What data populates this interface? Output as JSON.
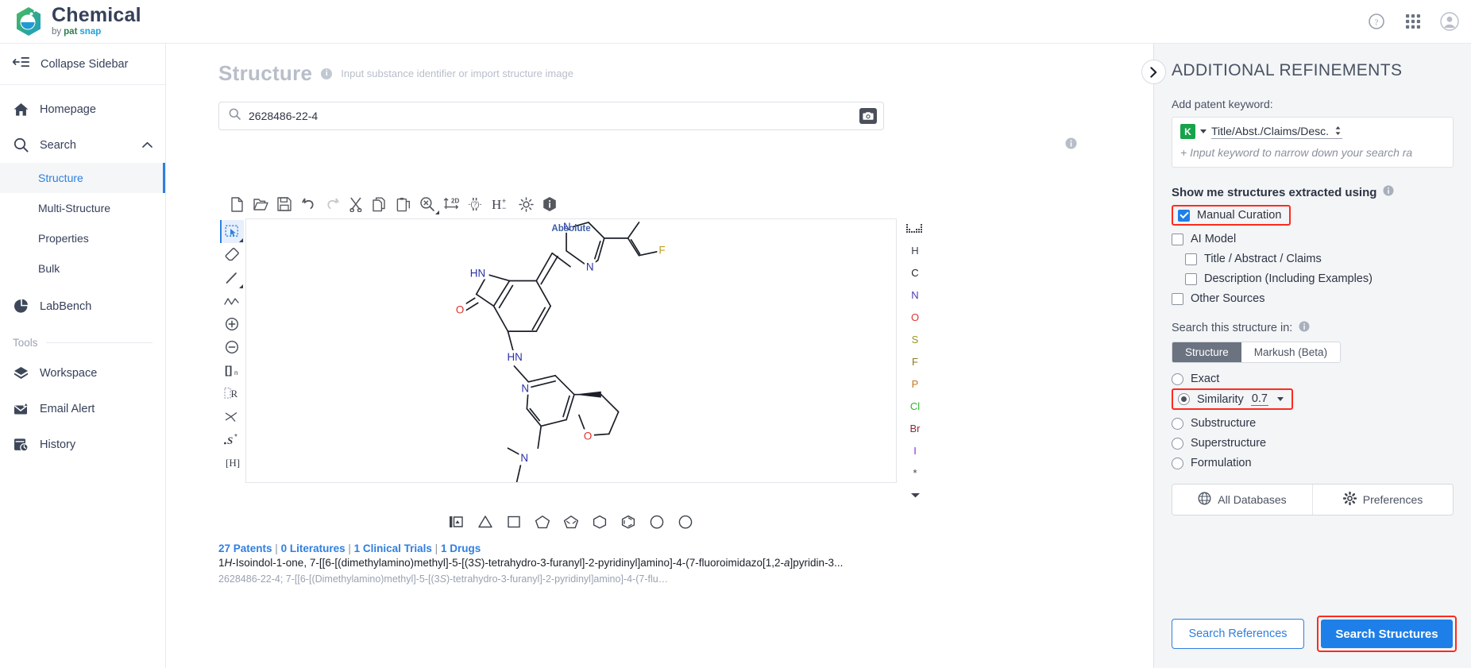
{
  "brand": {
    "name": "Chemical",
    "by": "by",
    "pat": "pat",
    "snap": "snap"
  },
  "topbar": {
    "help_icon": "help-circle-icon",
    "apps_icon": "grid-apps-icon",
    "avatar_icon": "user-avatar-icon"
  },
  "sidebar": {
    "collapse_label": "Collapse Sidebar",
    "items": [
      {
        "label": "Homepage",
        "icon": "home-icon"
      },
      {
        "label": "Search",
        "icon": "search-icon",
        "expanded": true
      }
    ],
    "search_children": [
      {
        "label": "Structure",
        "active": true
      },
      {
        "label": "Multi-Structure",
        "active": false
      },
      {
        "label": "Properties",
        "active": false
      },
      {
        "label": "Bulk",
        "active": false
      }
    ],
    "labbench": {
      "label": "LabBench",
      "icon": "pie-chart-icon"
    },
    "tools_header": "Tools",
    "tools": [
      {
        "label": "Workspace",
        "icon": "cube-icon"
      },
      {
        "label": "Email Alert",
        "icon": "mail-alert-icon"
      },
      {
        "label": "History",
        "icon": "history-clock-icon"
      }
    ]
  },
  "main": {
    "page_title": "Structure",
    "page_subtitle": "Input substance identifier or import structure image",
    "search_value": "2628486-22-4",
    "search_placeholder": "Input substance identifier or import structure image",
    "camera_icon": "camera-icon",
    "toolbar": [
      {
        "name": "new-file-icon",
        "title": "New"
      },
      {
        "name": "open-folder-icon",
        "title": "Open"
      },
      {
        "name": "save-disk-icon",
        "title": "Save"
      },
      {
        "name": "undo-icon",
        "title": "Undo"
      },
      {
        "name": "redo-icon",
        "title": "Redo"
      },
      {
        "name": "cut-scissors-icon",
        "title": "Cut"
      },
      {
        "name": "copy-icon",
        "title": "Copy"
      },
      {
        "name": "paste-icon",
        "title": "Paste"
      },
      {
        "name": "zoom-select-icon",
        "title": "Zoom"
      },
      {
        "name": "layout-2d-icon",
        "title": "2D Layout"
      },
      {
        "name": "query-properties-icon",
        "title": "Query"
      },
      {
        "name": "hydrogen-charge-icon",
        "title": "H +/-"
      },
      {
        "name": "settings-gear-icon",
        "title": "Settings"
      },
      {
        "name": "about-info-icon",
        "title": "About"
      }
    ],
    "left_tools": [
      {
        "name": "select-rectangle-tool",
        "label": "select",
        "active": true,
        "corner": true
      },
      {
        "name": "eraser-tool",
        "label": "eraser",
        "active": false,
        "corner": false
      },
      {
        "name": "bond-single-tool",
        "label": "bond",
        "active": false,
        "corner": true
      },
      {
        "name": "chain-tool",
        "label": "chain",
        "active": false,
        "corner": false
      },
      {
        "name": "charge-plus-tool",
        "label": "plus",
        "active": false,
        "corner": false
      },
      {
        "name": "charge-minus-tool",
        "label": "minus",
        "active": false,
        "corner": false
      },
      {
        "name": "repeat-bracket-tool",
        "label": "[ ]n",
        "active": false,
        "corner": false
      },
      {
        "name": "r-group-tool",
        "label": "R",
        "active": false,
        "corner": false
      },
      {
        "name": "stereo-flag-tool",
        "label": "stereo",
        "active": false,
        "corner": false
      },
      {
        "name": "s-group-tool",
        "label": ".S*",
        "active": false,
        "corner": false
      },
      {
        "name": "explicit-hydrogen-tool",
        "label": "[H]",
        "active": false,
        "corner": false
      }
    ],
    "canvas_label": "Absolute",
    "periodic_table_icon": "periodic-table-icon",
    "atoms": [
      {
        "symbol": "H",
        "color": "#3d424d"
      },
      {
        "symbol": "C",
        "color": "#1b1f28"
      },
      {
        "symbol": "N",
        "color": "#4b3bb0"
      },
      {
        "symbol": "O",
        "color": "#e0342b"
      },
      {
        "symbol": "S",
        "color": "#9a9522"
      },
      {
        "symbol": "F",
        "color": "#8a7a20"
      },
      {
        "symbol": "P",
        "color": "#c2781f"
      },
      {
        "symbol": "Cl",
        "color": "#2eb82e"
      },
      {
        "symbol": "Br",
        "color": "#8c2b3a"
      },
      {
        "symbol": "I",
        "color": "#8b2fc9"
      },
      {
        "symbol": "*",
        "color": "#3d424d"
      }
    ],
    "atoms_more_icon": "chevron-down-icon",
    "shapes": [
      {
        "name": "template-library-icon",
        "glyph": "templ"
      },
      {
        "name": "cyclopropane-icon",
        "glyph": "tri"
      },
      {
        "name": "cyclobutane-icon",
        "glyph": "sq"
      },
      {
        "name": "cyclopentane-icon",
        "glyph": "pent"
      },
      {
        "name": "cyclopentadiene-icon",
        "glyph": "pentd"
      },
      {
        "name": "cyclohexane-icon",
        "glyph": "hex"
      },
      {
        "name": "benzene-icon",
        "glyph": "benz"
      },
      {
        "name": "cycloheptane-icon",
        "glyph": "hept"
      },
      {
        "name": "cyclooctane-icon",
        "glyph": "oct"
      }
    ],
    "result": {
      "patents": "27 Patents",
      "literatures": "0 Literatures",
      "clinical": "1 Clinical Trials",
      "drugs": "1 Drugs",
      "name_html": "1H-Isoindol-1-one, 7-[[6-[(dimethylamino)methyl]-5-[(3S)-tetrahydro-3-furanyl]-2-pyridinyl]amino]-4-(7-fluoroimidazo[1,2-a]pyridin-3...",
      "alt": "2628486-22-4; 7-[[6-[(Dimethylamino)methyl]-5-[(3S)-tetrahydro-3-furanyl]-2-pyridinyl]amino]-4-(7-flu…"
    }
  },
  "rpanel": {
    "title": "ADDITIONAL REFINEMENTS",
    "toggle_icon": "chevron-right-icon",
    "keyword_label": "Add patent keyword:",
    "keyword_field_icon": "keyword-k-icon",
    "keyword_scope": "Title/Abst./Claims/Desc.",
    "keyword_placeholder": "+ Input keyword to narrow down your search ra",
    "extract_header": "Show me structures extracted using",
    "extract_info_icon": "info-icon",
    "extract_options": [
      {
        "label": "Manual Curation",
        "checked": true,
        "highlight": true,
        "indent": false
      },
      {
        "label": "AI Model",
        "checked": false,
        "highlight": false,
        "indent": false
      },
      {
        "label": "Title / Abstract / Claims",
        "checked": false,
        "highlight": false,
        "indent": true
      },
      {
        "label": "Description (Including Examples)",
        "checked": false,
        "highlight": false,
        "indent": true
      },
      {
        "label": "Other Sources",
        "checked": false,
        "highlight": false,
        "indent": false
      }
    ],
    "search_in_label": "Search this structure in:",
    "search_in_info_icon": "info-icon",
    "segments": [
      {
        "label": "Structure",
        "active": true
      },
      {
        "label": "Markush (Beta)",
        "active": false
      }
    ],
    "search_modes": [
      {
        "label": "Exact",
        "selected": false,
        "highlight": false,
        "value": null
      },
      {
        "label": "Similarity",
        "selected": true,
        "highlight": true,
        "value": "0.7"
      },
      {
        "label": "Substructure",
        "selected": false,
        "highlight": false,
        "value": null
      },
      {
        "label": "Superstructure",
        "selected": false,
        "highlight": false,
        "value": null
      },
      {
        "label": "Formulation",
        "selected": false,
        "highlight": false,
        "value": null
      }
    ],
    "all_databases": "All Databases",
    "all_databases_icon": "globe-icon",
    "preferences": "Preferences",
    "preferences_icon": "gear-icon",
    "search_references": "Search References",
    "search_structures": "Search Structures"
  },
  "colors": {
    "accent_blue": "#1e7fe8",
    "link_blue": "#2f7fe0",
    "highlight_red": "#ff2a1f",
    "panel_bg": "#f3f5f7",
    "text_dark": "#2e3443",
    "muted": "#9aa2b1"
  }
}
